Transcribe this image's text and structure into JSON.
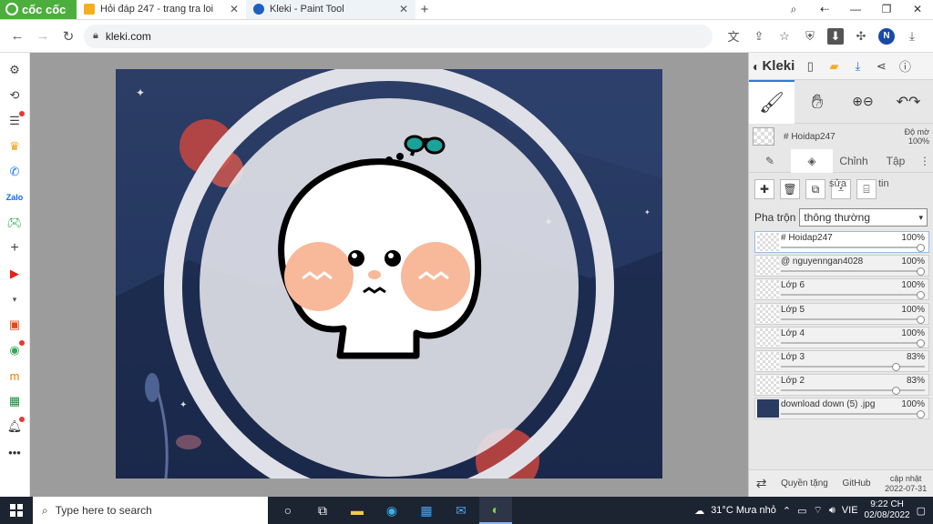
{
  "browser": {
    "brand": "cốc cốc",
    "tabs": [
      {
        "title": "Hỏi đáp 247 - trang tra loi",
        "active": false,
        "favicon_color": "#f2b01e"
      },
      {
        "title": "Kleki - Paint Tool",
        "active": true,
        "favicon_color": "#1f5fbf"
      }
    ],
    "url": "kleki.com",
    "avatar_letter": "N"
  },
  "kleki": {
    "logo": "Kleki",
    "brush_name": "# Hoidap247",
    "opacity_label": "Độ mờ",
    "opacity_value": "100%",
    "tabs": [
      "Chỉnh",
      "Tập"
    ],
    "layer_tool_label_1": "sửa",
    "layer_tool_label_2": "tin",
    "blend_label": "Pha trộn",
    "blend_value": "thông thường",
    "layers": [
      {
        "name": "# Hoidap247",
        "opacity": "100%",
        "level": 1.0,
        "active": true
      },
      {
        "name": "@ nguyenngan4028",
        "opacity": "100%",
        "level": 1.0,
        "active": false
      },
      {
        "name": "Lớp 6",
        "opacity": "100%",
        "level": 1.0,
        "active": false
      },
      {
        "name": "Lớp 5",
        "opacity": "100%",
        "level": 1.0,
        "active": false
      },
      {
        "name": "Lớp 4",
        "opacity": "100%",
        "level": 1.0,
        "active": false
      },
      {
        "name": "Lớp 3",
        "opacity": "83%",
        "level": 0.83,
        "active": false
      },
      {
        "name": "Lớp 2",
        "opacity": "83%",
        "level": 0.83,
        "active": false
      },
      {
        "name": "download down (5) .jpg",
        "opacity": "100%",
        "level": 1.0,
        "active": false
      }
    ],
    "footer": {
      "privacy": "Quyền tặng",
      "github": "GitHub",
      "updated_label": "cập nhật",
      "updated_date": "2022-07-31"
    }
  },
  "taskbar": {
    "search_placeholder": "Type here to search",
    "weather": "31°C  Mưa nhỏ",
    "language": "VIE",
    "time": "9:22 CH",
    "date": "02/08/2022"
  }
}
